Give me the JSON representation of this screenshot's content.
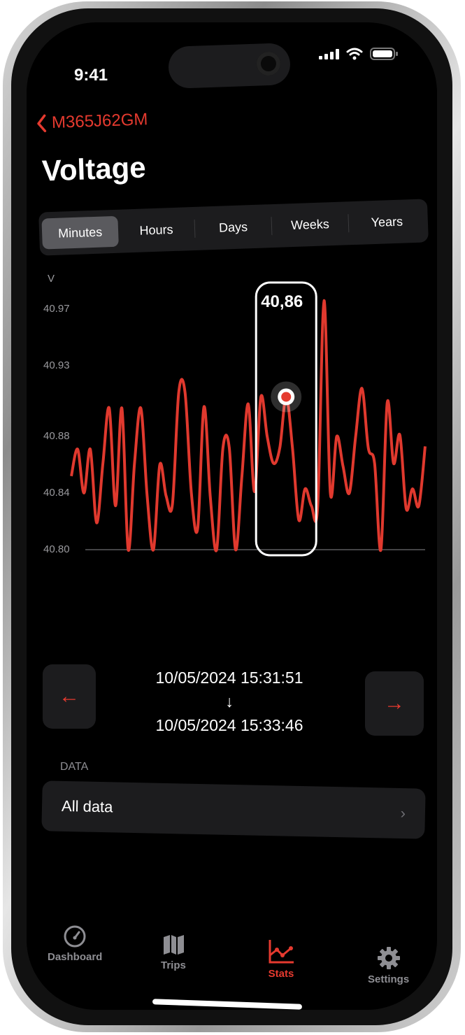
{
  "status_bar": {
    "time": "9:41",
    "icons": [
      "cellular-signal-icon",
      "wifi-icon",
      "battery-icon"
    ]
  },
  "nav": {
    "back_label": "M365J62GM",
    "back_icon": "chevron-left-icon"
  },
  "header": {
    "title": "Voltage"
  },
  "segments": [
    {
      "label": "Minutes",
      "active": true
    },
    {
      "label": "Hours",
      "active": false
    },
    {
      "label": "Days",
      "active": false
    },
    {
      "label": "Weeks",
      "active": false
    },
    {
      "label": "Years",
      "active": false
    }
  ],
  "colors": {
    "accent": "#e53a2f",
    "line": "#e0392e",
    "background": "#000000",
    "surface": "#1c1c1e"
  },
  "chart_data": {
    "type": "line",
    "title": "Voltage",
    "xlabel": "",
    "ylabel": "V",
    "ylim": [
      40.8,
      40.97
    ],
    "y_ticks": [
      "40.97",
      "40.93",
      "40.88",
      "40.84",
      "40.80"
    ],
    "y_tick_values": [
      40.97,
      40.93,
      40.88,
      40.84,
      40.8
    ],
    "grid": false,
    "baseline": 40.8,
    "highlight": {
      "index": 34,
      "label": "40,86"
    },
    "series": [
      {
        "name": "Voltage",
        "values": [
          40.852,
          40.871,
          40.84,
          40.871,
          40.819,
          40.861,
          40.9,
          40.831,
          40.9,
          40.8,
          40.861,
          40.9,
          40.838,
          40.8,
          40.86,
          40.838,
          40.832,
          40.911,
          40.911,
          40.84,
          40.815,
          40.901,
          40.837,
          40.8,
          40.872,
          40.872,
          40.8,
          40.852,
          40.903,
          40.841,
          40.908,
          40.88,
          40.861,
          40.872,
          40.908,
          40.872,
          40.821,
          40.843,
          40.831,
          40.831,
          40.976,
          40.84,
          40.88,
          40.859,
          40.84,
          40.88,
          40.914,
          40.872,
          40.861,
          40.8,
          40.904,
          40.861,
          40.881,
          40.829,
          40.843,
          40.831,
          40.873
        ]
      }
    ]
  },
  "range": {
    "start": "10/05/2024 15:31:51",
    "arrow": "↓",
    "end": "10/05/2024 15:33:46",
    "prev_icon": "arrow-left-icon",
    "next_icon": "arrow-right-icon"
  },
  "data_section": {
    "label": "DATA",
    "row_label": "All data"
  },
  "tabs": [
    {
      "label": "Dashboard",
      "icon": "speedometer-icon",
      "active": false
    },
    {
      "label": "Trips",
      "icon": "map-icon",
      "active": false
    },
    {
      "label": "Stats",
      "icon": "chart-line-icon",
      "active": true
    },
    {
      "label": "Settings",
      "icon": "gear-icon",
      "active": false
    }
  ]
}
